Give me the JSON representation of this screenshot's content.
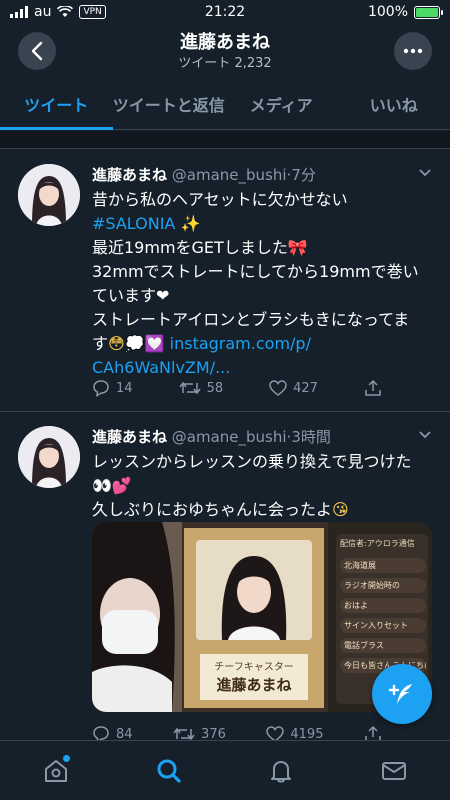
{
  "status": {
    "carrier": "au",
    "vpn": "VPN",
    "time": "21:22",
    "battery": "100%"
  },
  "header": {
    "title": "進藤あまね",
    "subtitle": "ツイート 2,232"
  },
  "tabs": [
    "ツイート",
    "ツイートと返信",
    "メディア",
    "いいね"
  ],
  "tweets": [
    {
      "name": "進藤あまね",
      "handle": "@amane_bushi",
      "time": "·7分",
      "lines": {
        "l1": "昔から私のヘアセットに欠かせない",
        "l2_tag": "#SALONIA",
        "l2_emoji": "✨",
        "l3": "最近19mmをGETしました",
        "l3_emoji": "🎀",
        "l4": "32mmでストレートにしてから19mmで巻い",
        "l5": "ています",
        "l5_emoji": "❤",
        "l6": "ストレートアイロンとブラシもきになってま",
        "l7": "す",
        "l7_emoji": "😳💭💟",
        "l7_link": "instagram.com/p/",
        "l8_link": "CAh6WaNlvZM/..."
      },
      "replies": "14",
      "retweets": "58",
      "likes": "427"
    },
    {
      "name": "進藤あまね",
      "handle": "@amane_bushi",
      "time": "·3時間",
      "lines": {
        "l1": "レッスンからレッスンの乗り換えで見つけた",
        "l2_emoji": "👀💕",
        "l3": "久しぶりにおゆちゃんに会ったよ",
        "l3_emoji": "😘"
      },
      "media": {
        "sign_small": "チーフキャスター",
        "sign_name": "進藤あまね",
        "app_header": "配信者:アウロラ通信",
        "app_rows": [
          "北海道展",
          "ラジオ開始時の",
          "おはよ",
          "サイン入りセット",
          "電話ブラス",
          "今日も皆さんこんにちは"
        ]
      },
      "replies": "84",
      "retweets": "376",
      "likes": "4195"
    }
  ],
  "nav": [
    "home-icon",
    "search-icon",
    "notifications-icon",
    "messages-icon"
  ],
  "colors": {
    "accent": "#1da1f2",
    "background": "#15202b",
    "muted": "#8899a6"
  }
}
